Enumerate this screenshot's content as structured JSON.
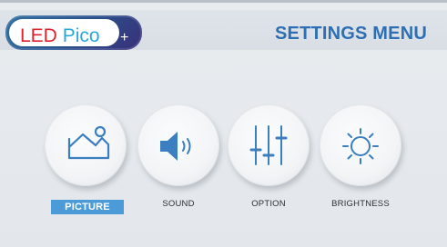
{
  "brand": {
    "led": "LED",
    "pico": "Pico",
    "plus": "+"
  },
  "header": {
    "title": "SETTINGS MENU"
  },
  "menu": {
    "items": [
      {
        "label": "PICTURE",
        "icon": "picture-icon",
        "selected": true
      },
      {
        "label": "SOUND",
        "icon": "speaker-icon",
        "selected": false
      },
      {
        "label": "OPTION",
        "icon": "sliders-icon",
        "selected": false
      },
      {
        "label": "BRIGHTNESS",
        "icon": "sun-icon",
        "selected": false
      }
    ]
  },
  "colors": {
    "accent": "#2e6fb3",
    "selected_label_bg": "#4a9bd8",
    "icon_stroke": "#3b7fc0"
  }
}
